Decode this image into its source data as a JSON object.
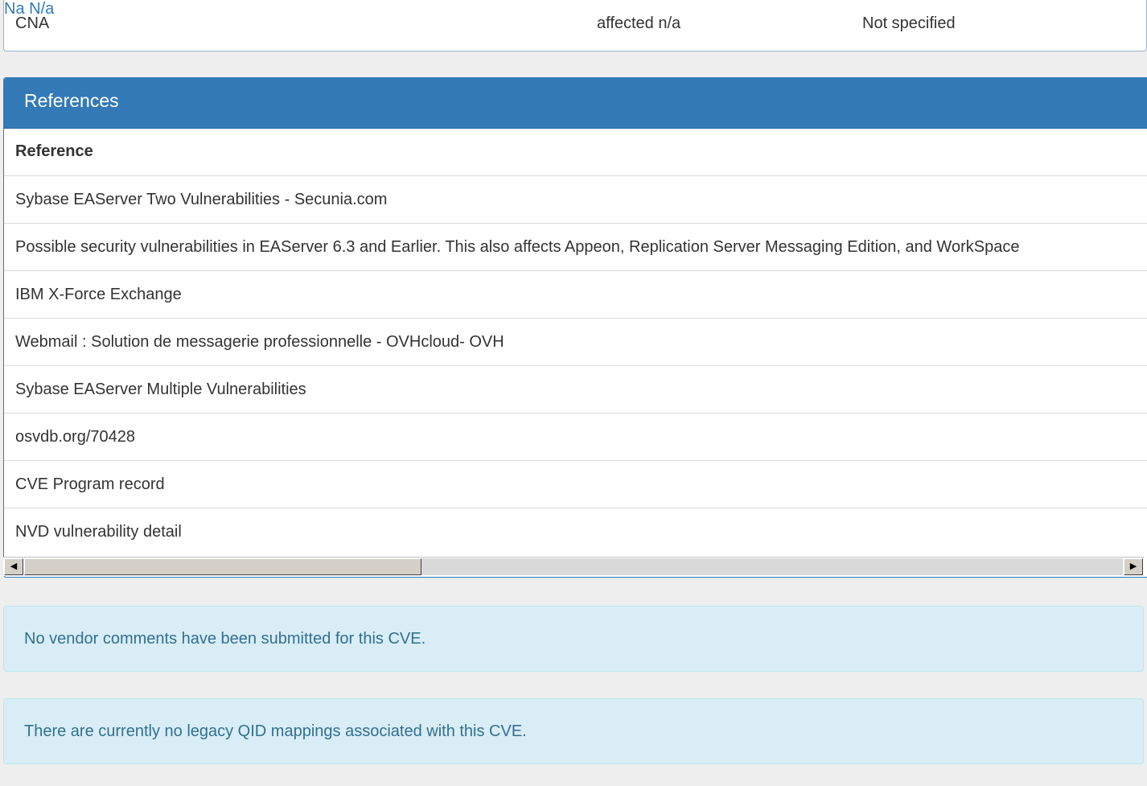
{
  "cna_row": {
    "source": "CNA",
    "vendor": "Na",
    "product": "N/a",
    "versions": "affected n/a",
    "status": "Not specified"
  },
  "references": {
    "heading": "References",
    "column_header": "Reference",
    "items": [
      "Sybase EAServer Two Vulnerabilities - Secunia.com",
      "Possible security vulnerabilities in EAServer 6.3 and Earlier. This also affects Appeon, Replication Server Messaging Edition, and WorkSpace",
      "IBM X-Force Exchange",
      "Webmail : Solution de messagerie professionnelle - OVHcloud- OVH",
      "Sybase EAServer Multiple Vulnerabilities",
      "osvdb.org/70428",
      "CVE Program record",
      "NVD vulnerability detail"
    ]
  },
  "scrollbar": {
    "left_arrow": "◀",
    "right_arrow": "▶"
  },
  "alerts": {
    "vendor_comments": "No vendor comments have been submitted for this CVE.",
    "qid_mappings": "There are currently no legacy QID mappings associated with this CVE."
  },
  "colors": {
    "panel_heading": "#337ab7",
    "link": "#337ab7",
    "alert_bg": "#d9edf7",
    "alert_text": "#31708f",
    "page_bg": "#eeeeee"
  }
}
